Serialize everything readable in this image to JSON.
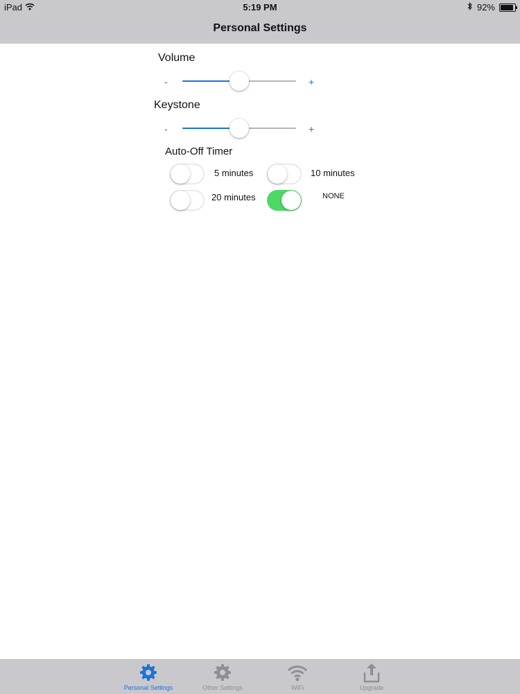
{
  "status_bar": {
    "device": "iPad",
    "time": "5:19 PM",
    "battery_text": "92%",
    "battery_level": 0.92
  },
  "nav": {
    "title": "Personal Settings"
  },
  "volume": {
    "label": "Volume",
    "minus": "-",
    "plus": "+",
    "value": 0.5
  },
  "keystone": {
    "label": "Keystone",
    "minus": "-",
    "plus": "+",
    "value": 0.5
  },
  "auto_off": {
    "label": "Auto-Off Timer",
    "options": [
      {
        "label": "5 minutes",
        "on": false
      },
      {
        "label": "10 minutes",
        "on": false
      },
      {
        "label": "20 minutes",
        "on": false
      },
      {
        "label": "NONE",
        "on": true
      }
    ]
  },
  "colors": {
    "accent": "#1a73d9",
    "switch_on": "#4cd964",
    "bar_bg": "#c9c8cd",
    "tab_inactive": "#8e8e93"
  },
  "tabs": [
    {
      "label": "Personal Settings",
      "icon": "gear-icon",
      "active": true
    },
    {
      "label": "Other Settings",
      "icon": "gear-icon",
      "active": false
    },
    {
      "label": "WiFi",
      "icon": "wifi-icon",
      "active": false
    },
    {
      "label": "Upgrade",
      "icon": "upload-icon",
      "active": false
    }
  ]
}
